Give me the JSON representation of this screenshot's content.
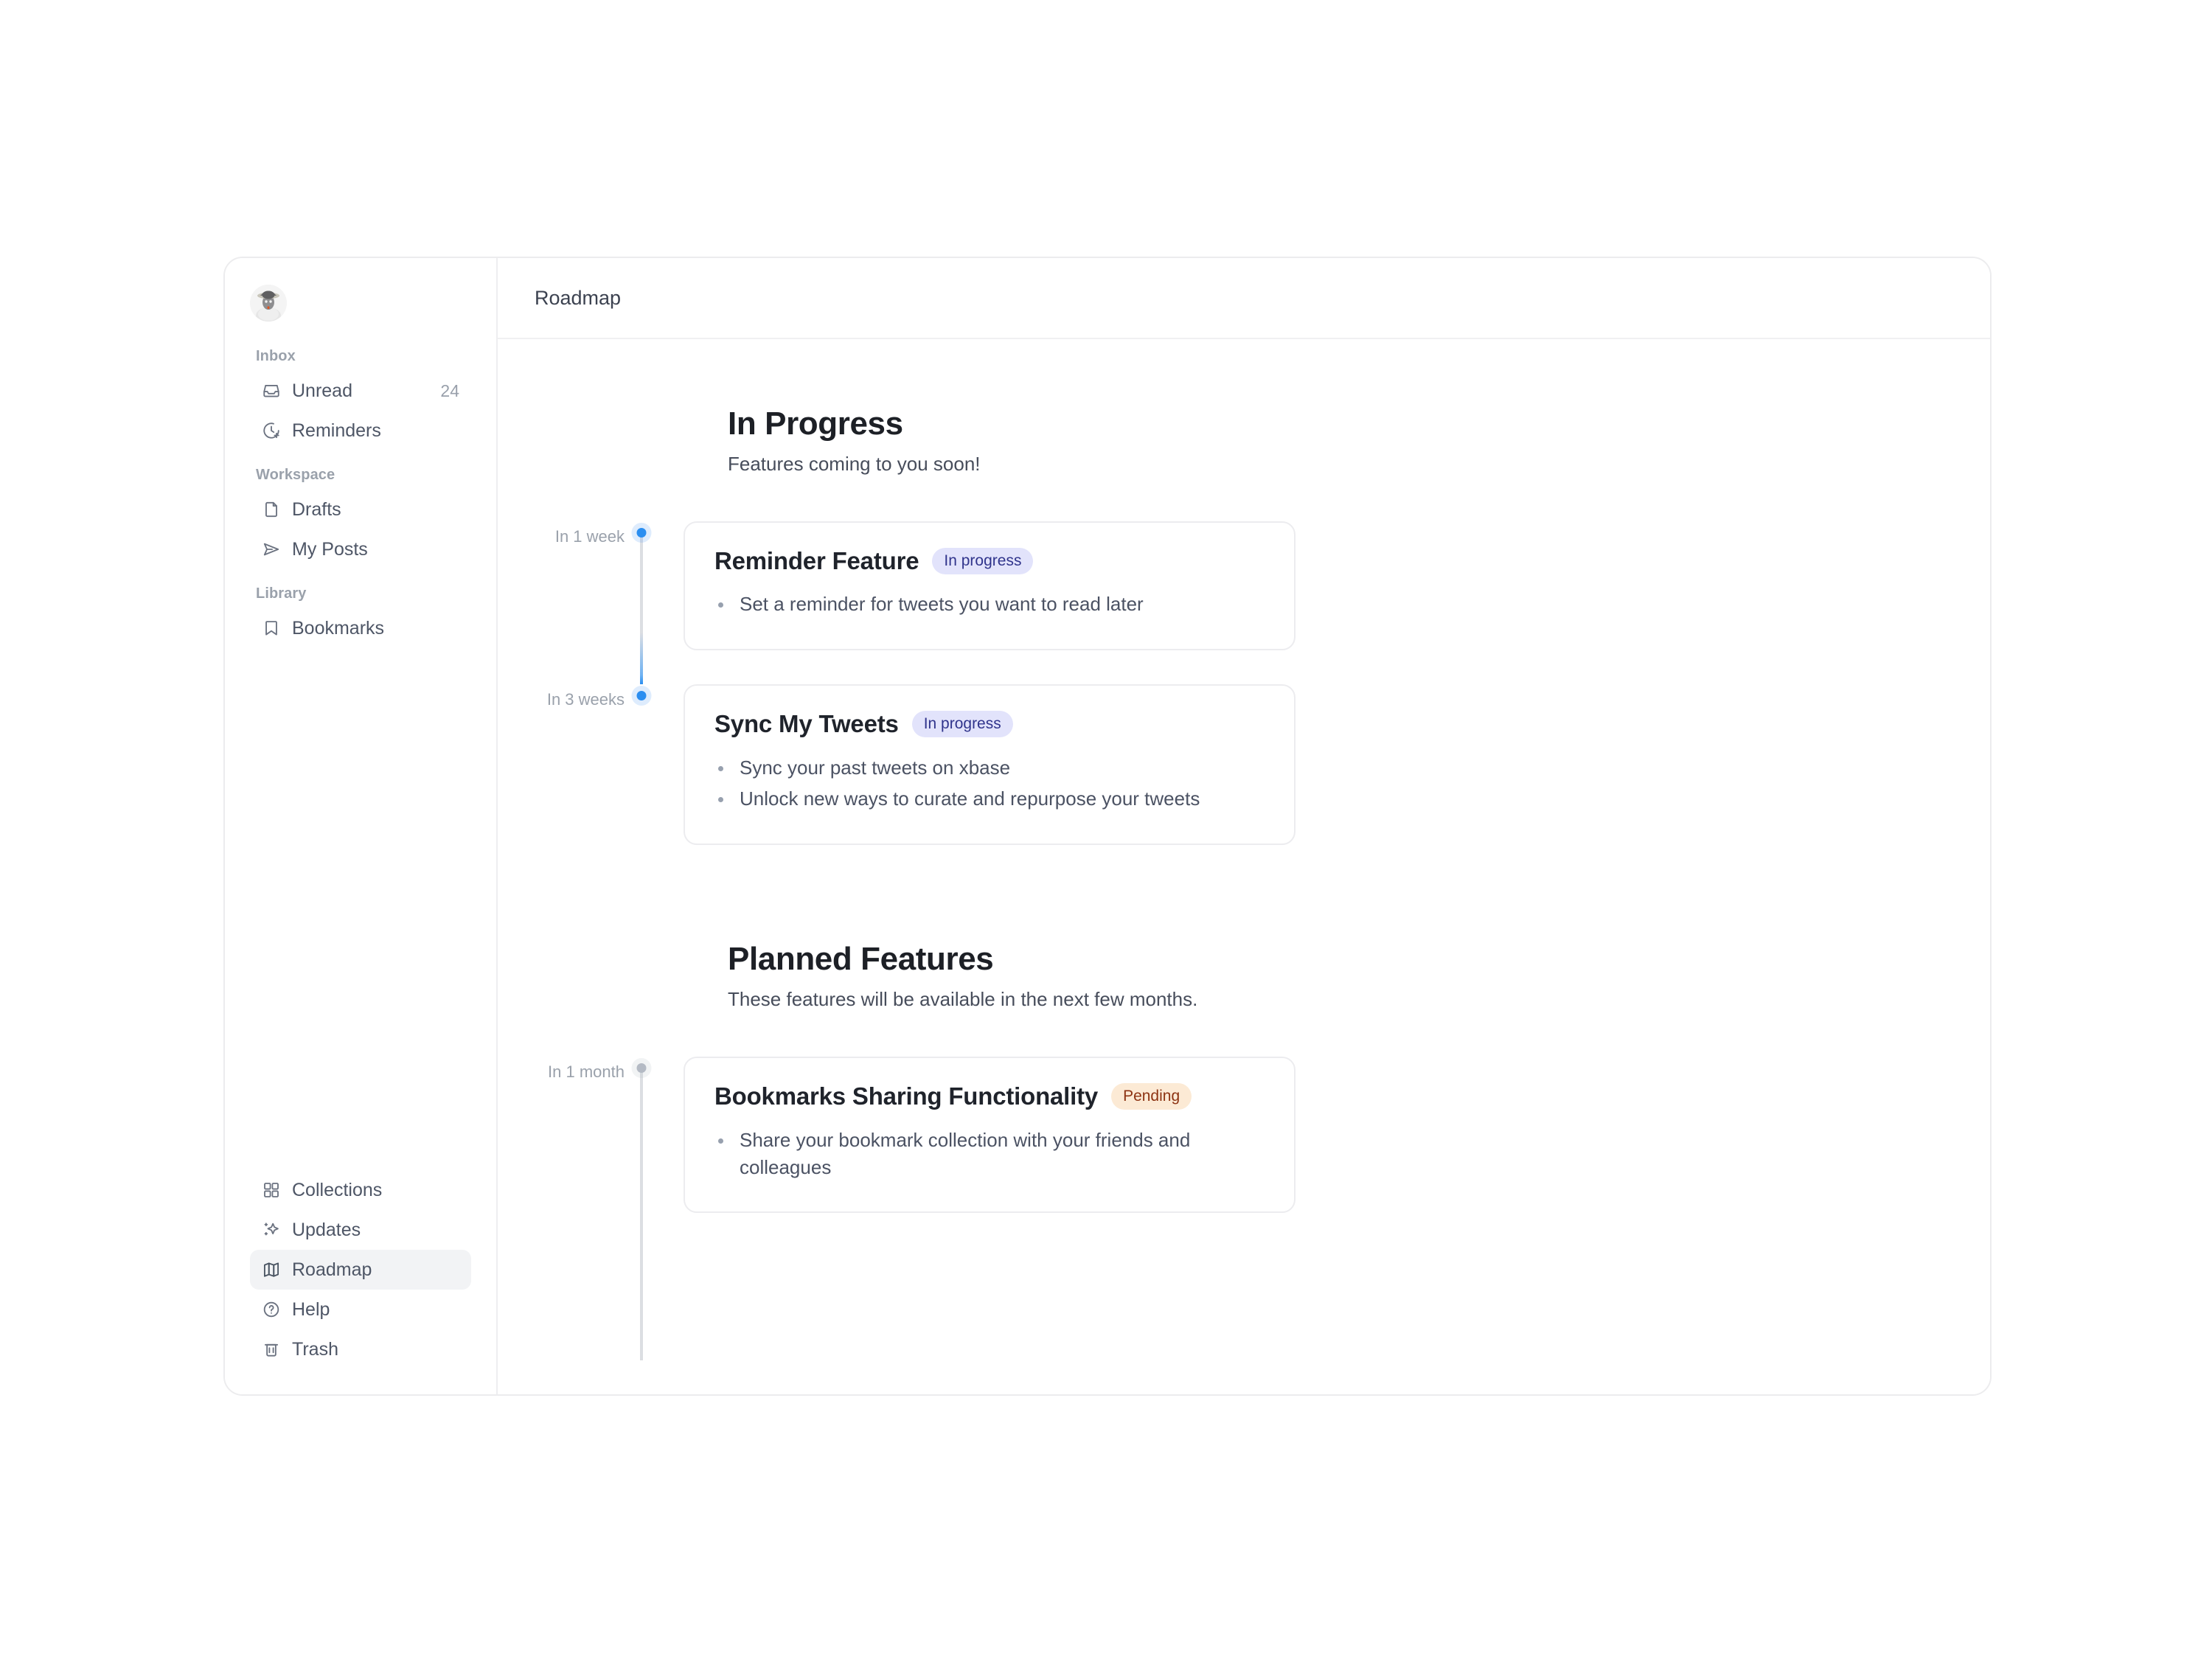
{
  "sidebar": {
    "avatar_alt": "user-avatar",
    "groups": [
      {
        "label": "Inbox",
        "items": [
          {
            "label": "Unread",
            "icon": "inbox-icon",
            "count": "24"
          },
          {
            "label": "Reminders",
            "icon": "clock-plus-icon"
          }
        ]
      },
      {
        "label": "Workspace",
        "items": [
          {
            "label": "Drafts",
            "icon": "file-icon"
          },
          {
            "label": "My Posts",
            "icon": "send-icon"
          }
        ]
      },
      {
        "label": "Library",
        "items": [
          {
            "label": "Bookmarks",
            "icon": "bookmark-icon"
          }
        ]
      }
    ],
    "bottom_items": [
      {
        "label": "Collections",
        "icon": "grid-icon",
        "active": false
      },
      {
        "label": "Updates",
        "icon": "sparkle-icon",
        "active": false
      },
      {
        "label": "Roadmap",
        "icon": "map-icon",
        "active": true
      },
      {
        "label": "Help",
        "icon": "question-circle-icon",
        "active": false
      },
      {
        "label": "Trash",
        "icon": "trash-icon",
        "active": false
      }
    ]
  },
  "header": {
    "breadcrumb": "Roadmap"
  },
  "main": {
    "sections": [
      {
        "title": "In Progress",
        "subtitle": "Features coming to you soon!",
        "items": [
          {
            "when": "In 1 week",
            "title": "Reminder Feature",
            "badge": "In progress",
            "badge_style": "inprogress",
            "dot_style": "active",
            "bullets": [
              "Set a reminder for tweets you want to read later"
            ]
          },
          {
            "when": "In 3 weeks",
            "title": "Sync My Tweets",
            "badge": "In progress",
            "badge_style": "inprogress",
            "dot_style": "active",
            "bullets": [
              "Sync your past tweets on xbase",
              "Unlock new ways to curate and repurpose your tweets"
            ]
          }
        ]
      },
      {
        "title": "Planned Features",
        "subtitle": "These features will be available in the next few months.",
        "items": [
          {
            "when": "In 1 month",
            "title": "Bookmarks Sharing Functionality",
            "badge": "Pending",
            "badge_style": "pending",
            "dot_style": "muted",
            "bullets": [
              "Share your bookmark collection with your friends and colleagues"
            ]
          }
        ]
      }
    ]
  },
  "colors": {
    "accent_blue": "#2b8ef0",
    "badge_inprogress_bg": "#e2e3fb",
    "badge_inprogress_fg": "#30348c",
    "badge_pending_bg": "#fcead5",
    "badge_pending_fg": "#8d3312",
    "rail_gray": "#dcdee2",
    "sidebar_active_bg": "#f2f3f5"
  }
}
